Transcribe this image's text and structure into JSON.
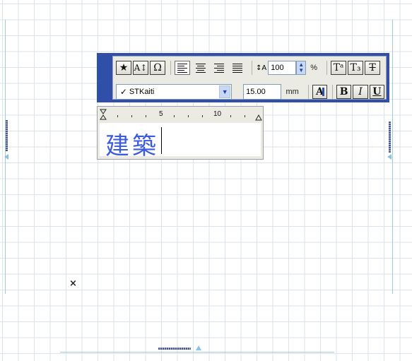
{
  "toolbar": {
    "row1": {
      "buttons": [
        {
          "name": "favorites-button",
          "icon": "star-icon",
          "glyph": "★"
        },
        {
          "name": "text-size-button",
          "icon": "text-resize-icon",
          "glyph": "A↕"
        },
        {
          "name": "special-character-button",
          "icon": "omega-icon",
          "glyph": "Ω"
        }
      ],
      "line_spacing_icon": "line-spacing-icon",
      "line_spacing_glyph": "↕A",
      "line_spacing_value": "100",
      "line_spacing_unit": "%",
      "superscript_label": "Tᵃ",
      "subscript_label": "T₃",
      "strikethrough_label": "T"
    },
    "row2": {
      "font_check": "✓",
      "font_name": "STKaiti",
      "font_size_value": "15.00",
      "font_size_unit": "mm",
      "color_label": "A",
      "bold_label": "B",
      "italic_label": "I",
      "underline_label": "U"
    }
  },
  "ruler": {
    "labels": [
      "5",
      "10"
    ]
  },
  "editor": {
    "text": "建築"
  },
  "canvas": {
    "marker": "×"
  },
  "colors": {
    "toolbar_frame": "#2f4fa8",
    "text_color": "#3b5bdc",
    "guide_line": "#9cc8ea"
  }
}
